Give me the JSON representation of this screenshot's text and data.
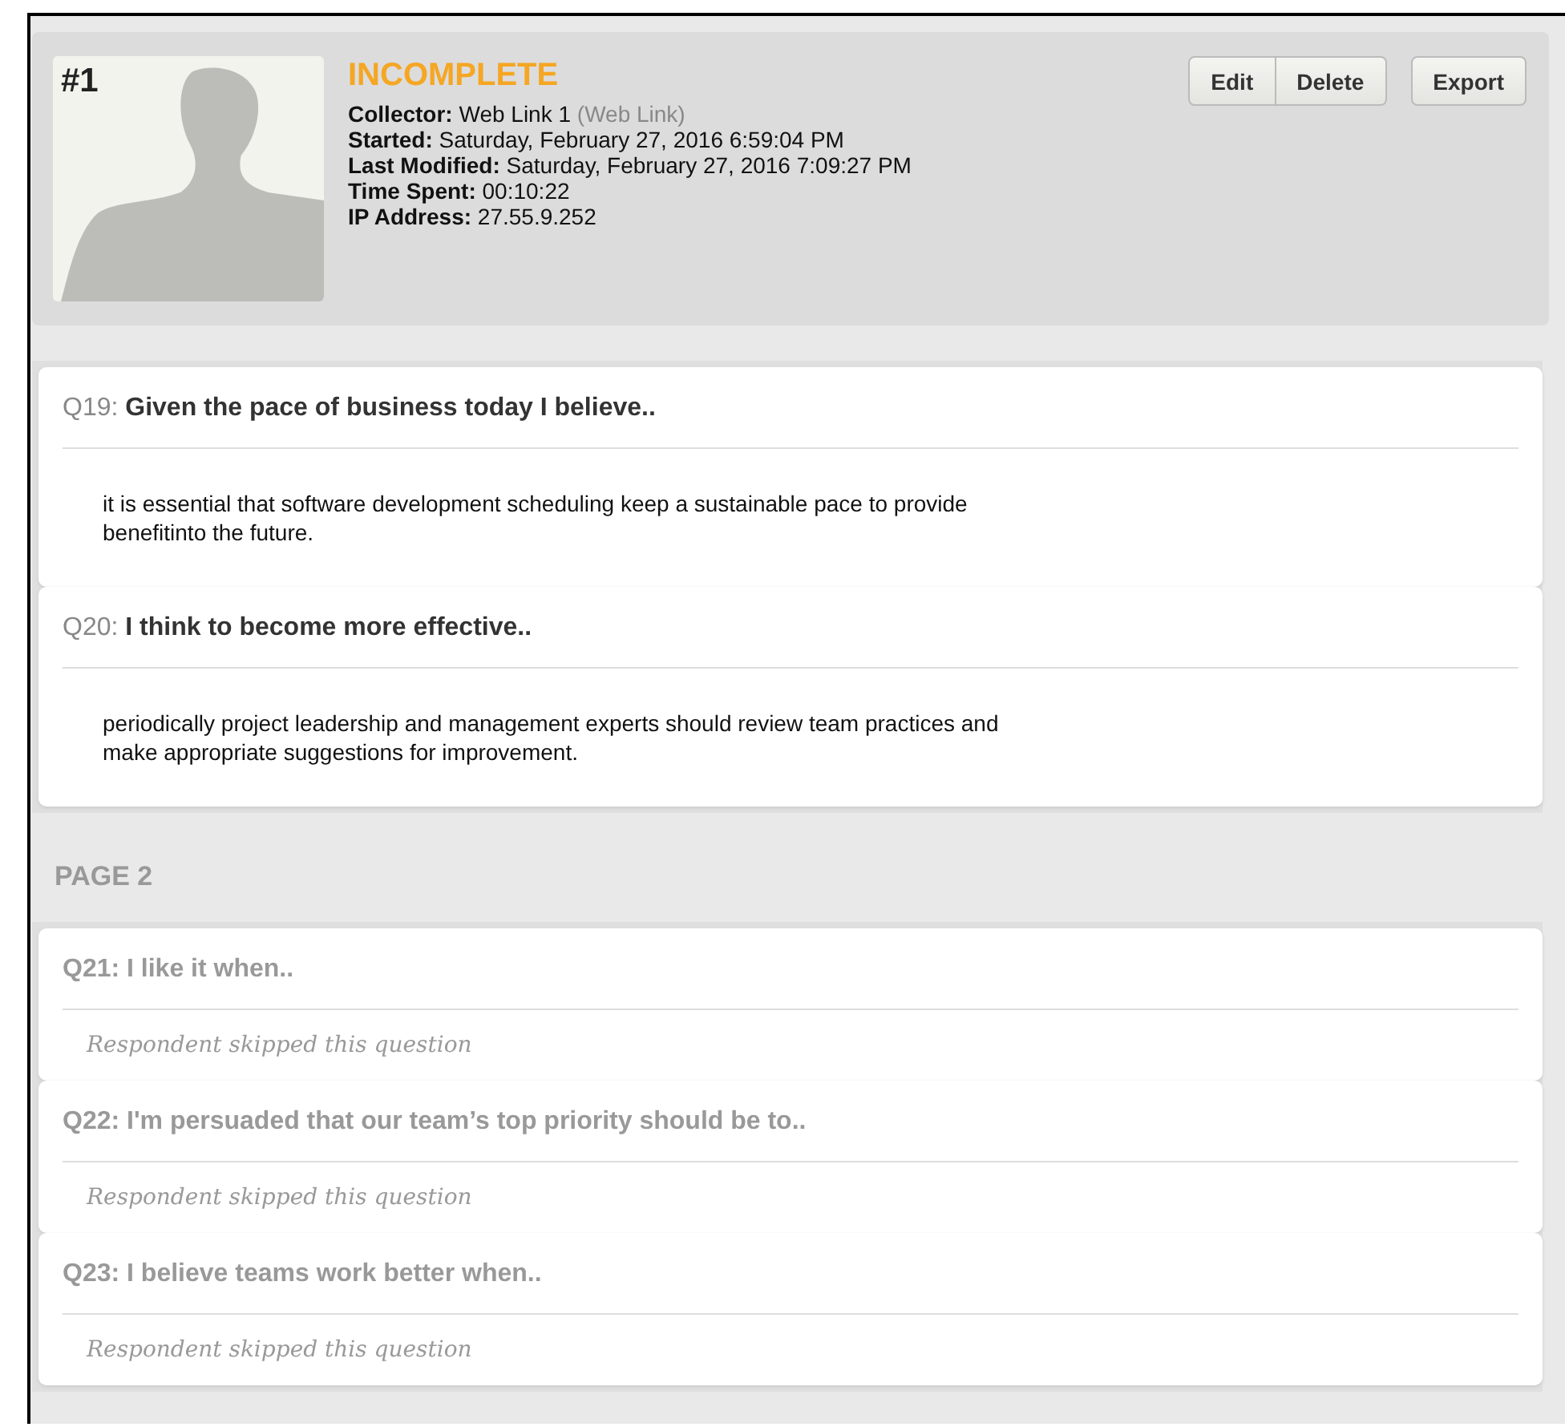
{
  "response": {
    "number": "#1",
    "status": "INCOMPLETE",
    "details": [
      {
        "label": "Collector:",
        "value": "Web Link 1",
        "note": "(Web Link)"
      },
      {
        "label": "Started:",
        "value": "Saturday, February 27, 2016 6:59:04 PM"
      },
      {
        "label": "Last Modified:",
        "value": "Saturday, February 27, 2016 7:09:27 PM"
      },
      {
        "label": "Time Spent:",
        "value": "00:10:22"
      },
      {
        "label": "IP Address:",
        "value": "27.55.9.252"
      }
    ],
    "button_groups": [
      [
        "Edit",
        "Delete"
      ],
      [
        "Export"
      ]
    ]
  },
  "pages": [
    {
      "questions": [
        {
          "number": "Q19:",
          "title": "Given the pace of business today I believe..",
          "skipped": false,
          "answer": "it is essential that software development scheduling keep a sustainable pace to provide benefitinto the future."
        },
        {
          "number": "Q20:",
          "title": "I think to become more effective..",
          "skipped": false,
          "answer": "periodically project leadership and management experts should review team practices and make appropriate suggestions for improvement."
        }
      ]
    },
    {
      "title": "PAGE 2",
      "questions": [
        {
          "number": "Q21:",
          "title": "I like it when..",
          "skipped": true,
          "answer": "Respondent skipped this question"
        },
        {
          "number": "Q22:",
          "title": "I'm persuaded that our team’s top priority should be to..",
          "skipped": true,
          "answer": "Respondent skipped this question"
        },
        {
          "number": "Q23:",
          "title": "I believe teams work better when..",
          "skipped": true,
          "answer": "Respondent skipped this question"
        }
      ]
    }
  ]
}
